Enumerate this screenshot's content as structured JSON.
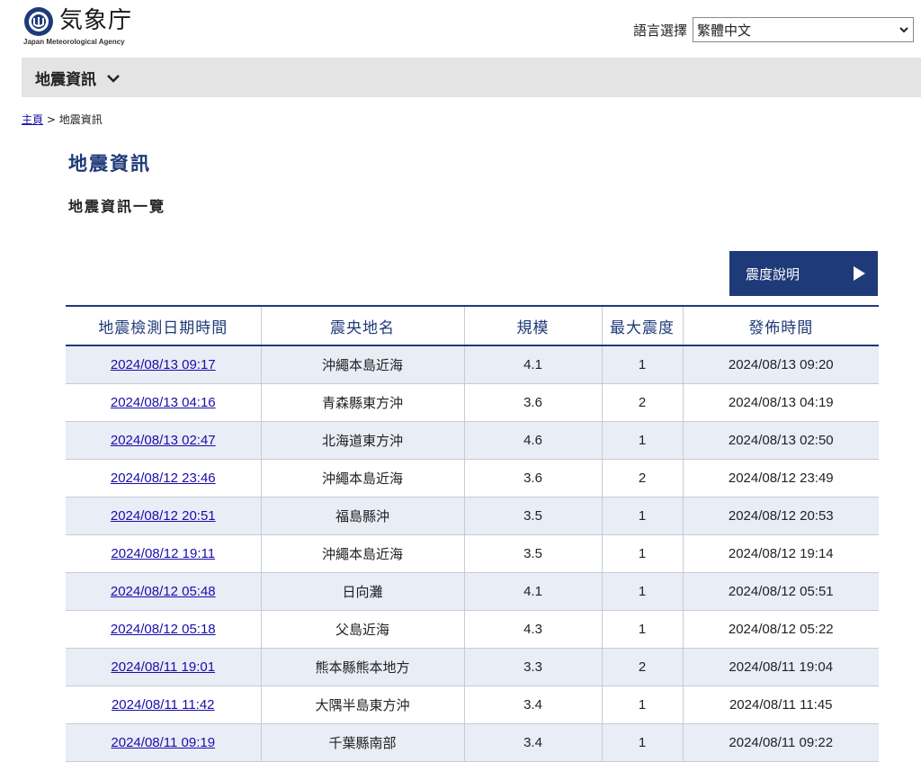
{
  "header": {
    "logo_text": "気象庁",
    "logo_sub": "Japan Meteorological Agency",
    "lang_label": "語言選擇",
    "lang_selected": "繁體中文"
  },
  "nav": {
    "title": "地震資訊"
  },
  "breadcrumb": {
    "home": "主頁",
    "sep": ">",
    "current": "地震資訊"
  },
  "page": {
    "title": "地震資訊",
    "subtitle": "地震資訊一覽",
    "intensity_button": "震度說明"
  },
  "table": {
    "columns": [
      "地震檢測日期時間",
      "震央地名",
      "規模",
      "最大震度",
      "發佈時間"
    ],
    "rows": [
      {
        "detected": "2024/08/13 09:17",
        "epicenter": "沖繩本島近海",
        "magnitude": "4.1",
        "max_intensity": "1",
        "issued": "2024/08/13 09:20"
      },
      {
        "detected": "2024/08/13 04:16",
        "epicenter": "青森縣東方沖",
        "magnitude": "3.6",
        "max_intensity": "2",
        "issued": "2024/08/13 04:19"
      },
      {
        "detected": "2024/08/13 02:47",
        "epicenter": "北海道東方沖",
        "magnitude": "4.6",
        "max_intensity": "1",
        "issued": "2024/08/13 02:50"
      },
      {
        "detected": "2024/08/12 23:46",
        "epicenter": "沖繩本島近海",
        "magnitude": "3.6",
        "max_intensity": "2",
        "issued": "2024/08/12 23:49"
      },
      {
        "detected": "2024/08/12 20:51",
        "epicenter": "福島縣沖",
        "magnitude": "3.5",
        "max_intensity": "1",
        "issued": "2024/08/12 20:53"
      },
      {
        "detected": "2024/08/12 19:11",
        "epicenter": "沖繩本島近海",
        "magnitude": "3.5",
        "max_intensity": "1",
        "issued": "2024/08/12 19:14"
      },
      {
        "detected": "2024/08/12 05:48",
        "epicenter": "日向灘",
        "magnitude": "4.1",
        "max_intensity": "1",
        "issued": "2024/08/12 05:51"
      },
      {
        "detected": "2024/08/12 05:18",
        "epicenter": "父島近海",
        "magnitude": "4.3",
        "max_intensity": "1",
        "issued": "2024/08/12 05:22"
      },
      {
        "detected": "2024/08/11 19:01",
        "epicenter": "熊本縣熊本地方",
        "magnitude": "3.3",
        "max_intensity": "2",
        "issued": "2024/08/11 19:04"
      },
      {
        "detected": "2024/08/11 11:42",
        "epicenter": "大隅半島東方沖",
        "magnitude": "3.4",
        "max_intensity": "1",
        "issued": "2024/08/11 11:45"
      },
      {
        "detected": "2024/08/11 09:19",
        "epicenter": "千葉縣南部",
        "magnitude": "3.4",
        "max_intensity": "1",
        "issued": "2024/08/11 09:22"
      }
    ]
  },
  "colors": {
    "accent": "#1f3a78",
    "row_stripe": "#e8edf6",
    "nav_bg": "#e4e4e4",
    "link": "#1a0dab"
  },
  "icons": {
    "logo": "jma-logo-icon",
    "nav_chevron": "chevron-down-icon",
    "select_chevron": "chevron-down-icon",
    "button_arrow": "play-arrow-icon"
  }
}
